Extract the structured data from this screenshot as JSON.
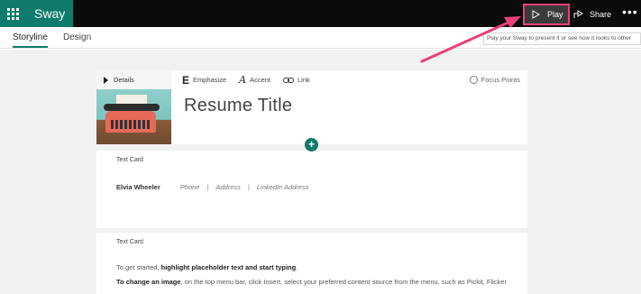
{
  "app": {
    "name": "Sway"
  },
  "header": {
    "play_label": "Play",
    "share_label": "Share",
    "more_label": "•••"
  },
  "tabs": [
    {
      "label": "Storyline",
      "active": true
    },
    {
      "label": "Design",
      "active": false
    }
  ],
  "tooltip": "Play your Sway to present it or see how it looks to other",
  "title_card": {
    "details_label": "Details",
    "toolbar": {
      "emphasize": "Emphasize",
      "accent": "Accent",
      "link": "Link"
    },
    "focus_points": "Focus Points",
    "title": "Resume Title"
  },
  "text_card_1": {
    "label": "Text Card",
    "name": "Elvia Wheeler",
    "phone": "Phone",
    "address": "Address",
    "linkedin": "LinkedIn Address",
    "separator": "|"
  },
  "text_card_2": {
    "label": "Text Card",
    "line1_pre": "To get started, ",
    "line1_bold": "highlight placeholder text and start typing",
    "line1_post": ".",
    "line2_bold": "To change an image",
    "line2_rest": ", on the top menu bar, click Insert, select your preferred content source from the menu, such as Pickit, Flicker"
  },
  "icons": {
    "waffle": "app-launcher-icon",
    "play": "play-icon",
    "share": "share-icon",
    "details": "triangle-right-icon",
    "emphasize": "emphasize-icon",
    "accent": "accent-icon",
    "link": "link-icon",
    "focus": "focus-points-icon",
    "add": "plus-icon"
  },
  "colors": {
    "brand": "#0f7b6c",
    "highlight": "#e8407a",
    "topbar": "#0b0b0b"
  }
}
